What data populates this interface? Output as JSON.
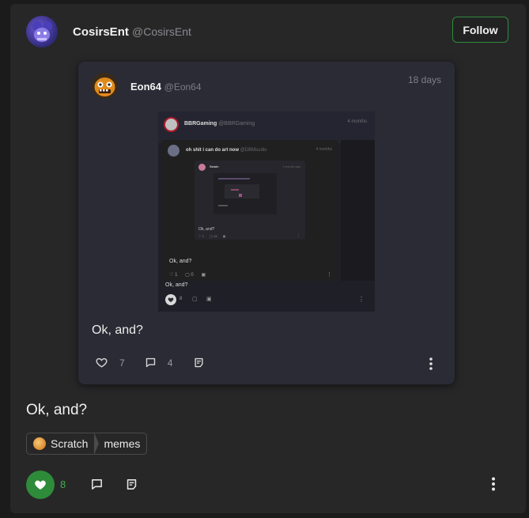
{
  "post": {
    "author_name": "CosirsEnt",
    "author_handle": "@CosirsEnt",
    "follow_label": "Follow",
    "text": "Ok, and?",
    "tag": {
      "first": "Scratch",
      "second": "memes"
    },
    "like_count": "8",
    "liked": true
  },
  "quoted": {
    "author_name": "Eon64",
    "author_handle": "@Eon64",
    "time": "18 days",
    "text": "Ok, and?",
    "like_count": "7",
    "comment_count": "4"
  },
  "nested": {
    "author_name": "BBRGaming",
    "author_handle": "@BBRGaming",
    "time": "4 months",
    "inner_author": "oh shit i can do art now",
    "inner_handle": "@DBMsudio",
    "inner_time": "4 months",
    "inner_text": "Ok, and?",
    "inner_like_count": "1",
    "inner_comment_count": "0",
    "deep_author": "Swain",
    "deep_time": "1 month ago",
    "deep_text": "Ok, and?",
    "deep_like_count": "1",
    "deep_comment_count": "13",
    "text": "Ok, and?",
    "like_count": "8"
  },
  "colors": {
    "accent": "#2e8b3a",
    "like_green": "#38a64a"
  },
  "icons": [
    "heart-icon",
    "comment-icon",
    "repost-icon",
    "more-vertical-icon"
  ]
}
